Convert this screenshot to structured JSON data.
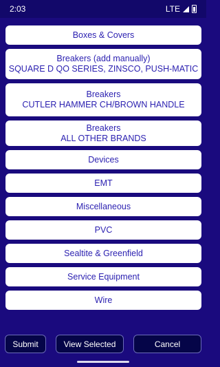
{
  "status_bar": {
    "time": "2:03",
    "network": "LTE"
  },
  "categories": [
    {
      "lines": [
        "Boxes & Covers"
      ]
    },
    {
      "lines": [
        "Breakers (add manually)",
        "SQUARE D QO SERIES, ZINSCO, PUSH-MATIC"
      ]
    },
    {
      "lines": [
        "Breakers",
        "CUTLER HAMMER CH/BROWN HANDLE"
      ]
    },
    {
      "lines": [
        "Breakers",
        "ALL OTHER BRANDS"
      ]
    },
    {
      "lines": [
        "Devices"
      ]
    },
    {
      "lines": [
        "EMT"
      ]
    },
    {
      "lines": [
        "Miscellaneous"
      ]
    },
    {
      "lines": [
        "PVC"
      ]
    },
    {
      "lines": [
        "Sealtite & Greenfield"
      ]
    },
    {
      "lines": [
        "Service Equipment"
      ]
    },
    {
      "lines": [
        "Wire"
      ]
    }
  ],
  "actions": {
    "submit_label": "Submit",
    "view_selected_label": "View Selected",
    "cancel_label": "Cancel"
  },
  "colors": {
    "background": "#1a0a7e",
    "status_bar": "#12086a",
    "item_text": "#2a1fb0",
    "button_bg": "#050548"
  }
}
